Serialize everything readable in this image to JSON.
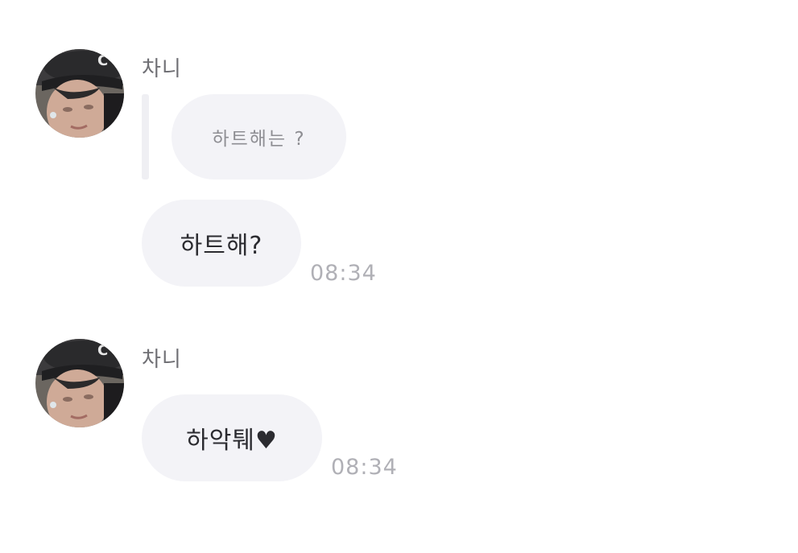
{
  "messages": [
    {
      "sender": "차니",
      "avatar_icon": "profile-avatar-icon",
      "quoted_reply": "하트해는 ?",
      "text": "하트해?",
      "time": "08:34"
    },
    {
      "sender": "차니",
      "avatar_icon": "profile-avatar-icon",
      "text": "하악퉤♥",
      "time": "08:34"
    }
  ],
  "colors": {
    "bubble": "#f3f3f7",
    "text": "#2b2b30",
    "timestamp": "#b0b0b6",
    "sender_name": "#6f6f74"
  }
}
